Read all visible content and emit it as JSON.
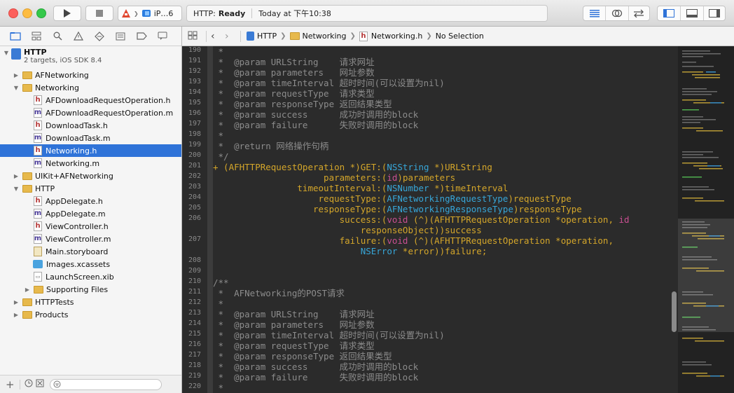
{
  "toolbar": {
    "scheme_label": "iP…6",
    "status_project": "HTTP:",
    "status_state": "Ready",
    "status_time": "Today at 下午10:38"
  },
  "navigator": {
    "project": {
      "name": "HTTP",
      "subtitle": "2 targets, iOS SDK 8.4"
    },
    "items": [
      {
        "label": "AFNetworking"
      },
      {
        "label": "Networking"
      },
      {
        "label": "AFDownloadRequestOperation.h"
      },
      {
        "label": "AFDownloadRequestOperation.m"
      },
      {
        "label": "DownloadTask.h"
      },
      {
        "label": "DownloadTask.m"
      },
      {
        "label": "Networking.h"
      },
      {
        "label": "Networking.m"
      },
      {
        "label": "UIKit+AFNetworking"
      },
      {
        "label": "HTTP"
      },
      {
        "label": "AppDelegate.h"
      },
      {
        "label": "AppDelegate.m"
      },
      {
        "label": "ViewController.h"
      },
      {
        "label": "ViewController.m"
      },
      {
        "label": "Main.storyboard"
      },
      {
        "label": "Images.xcassets"
      },
      {
        "label": "LaunchScreen.xib"
      },
      {
        "label": "Supporting Files"
      },
      {
        "label": "HTTPTests"
      },
      {
        "label": "Products"
      }
    ]
  },
  "jumpbar": {
    "crumbs": [
      "HTTP",
      "Networking",
      "Networking.h",
      "No Selection"
    ]
  },
  "editor": {
    "line_numbers": [
      "190",
      "191",
      "192",
      "193",
      "194",
      "195",
      "196",
      "197",
      "198",
      "199",
      "200",
      "201",
      "202",
      "203",
      "204",
      "205",
      "206",
      "207",
      "208",
      "209",
      "210",
      "211",
      "212",
      "213",
      "214",
      "215",
      "216",
      "217",
      "218",
      "219",
      "220"
    ]
  },
  "colors": {
    "selection": "#2f73d8",
    "comment": "#8c8c8c",
    "keyword": "#d4a62a",
    "type": "#37a6d8",
    "void": "#c94f92",
    "editor_bg": "#2b2b2b"
  }
}
